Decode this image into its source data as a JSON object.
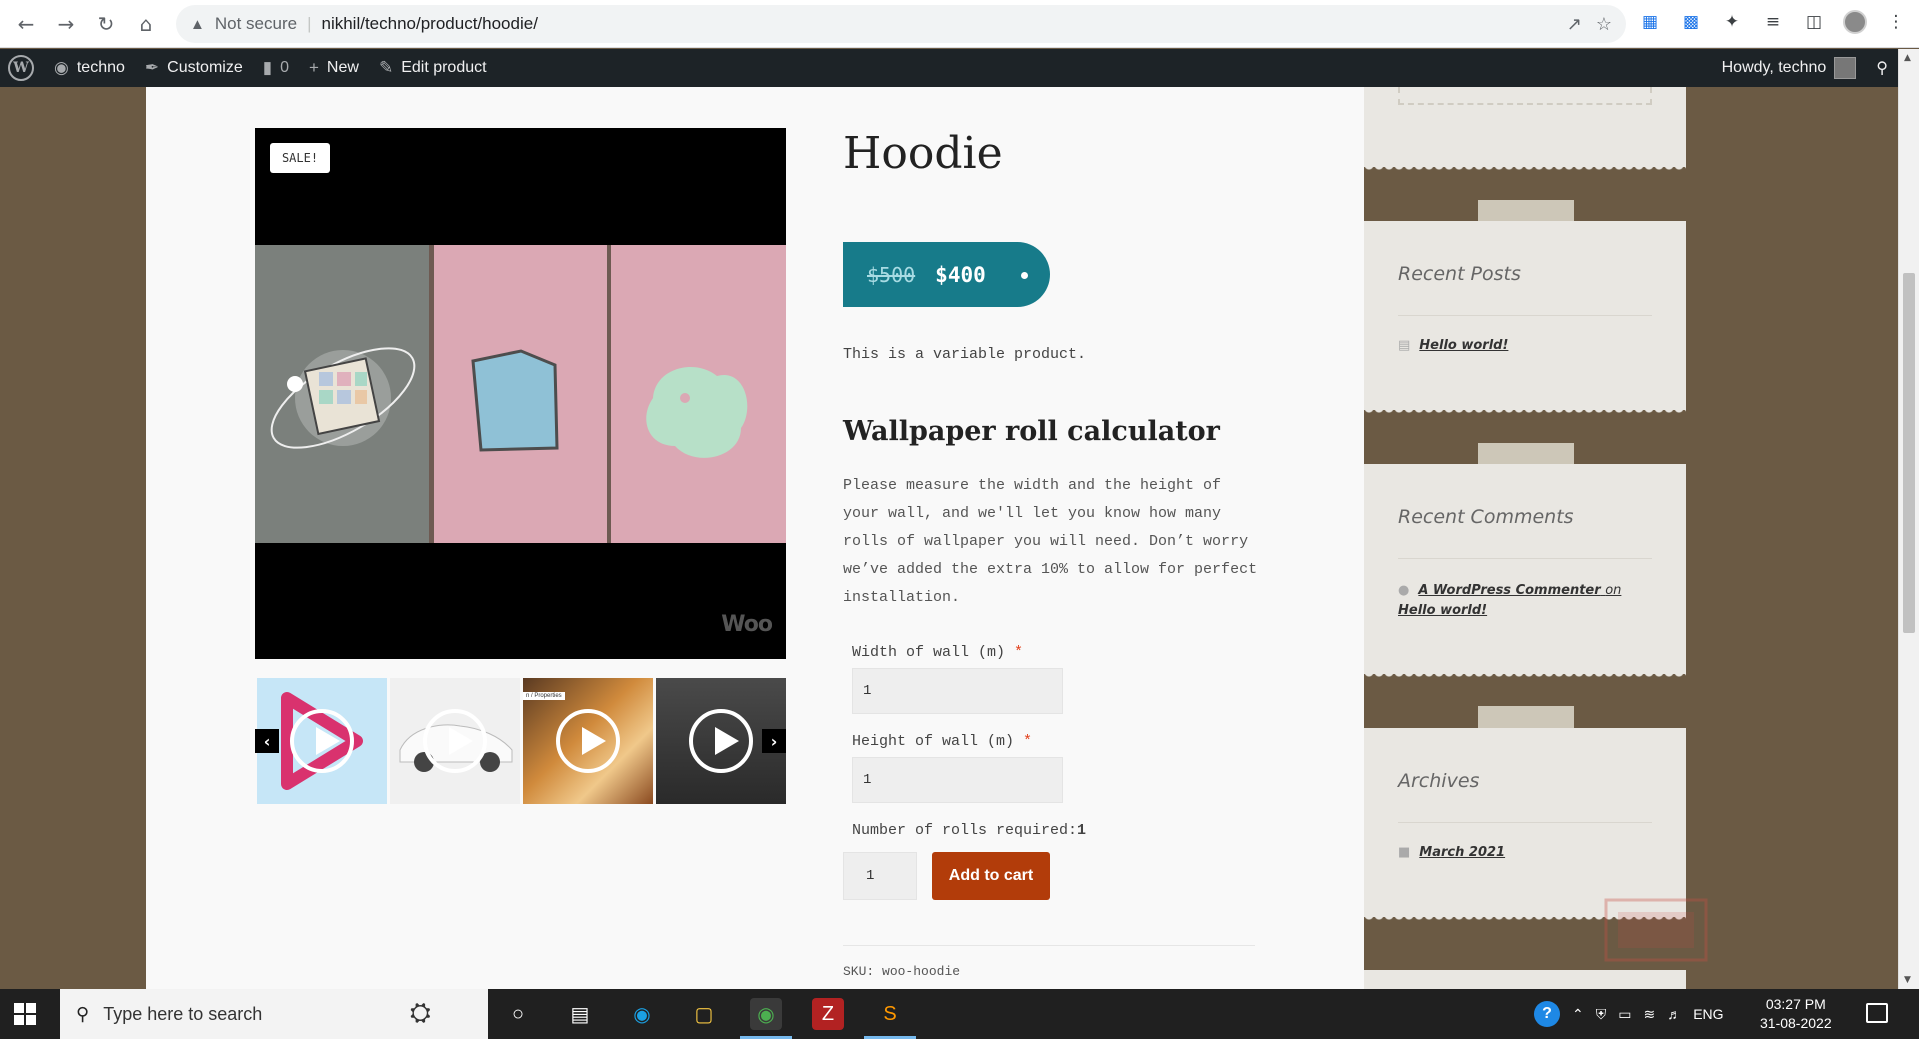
{
  "browser": {
    "security_label": "Not secure",
    "url": "nikhil/techno/product/hoodie/"
  },
  "adminbar": {
    "site_name": "techno",
    "customize": "Customize",
    "comments_count": "0",
    "new_label": "New",
    "edit_label": "Edit product",
    "howdy": "Howdy, techno"
  },
  "product": {
    "sale_badge": "SALE!",
    "title": "Hoodie",
    "price_old": "$500",
    "price_new": "$400",
    "short_description": "This is a variable product.",
    "brand_watermark": "Woo",
    "sku_label": "SKU:",
    "sku_value": "woo-hoodie",
    "quantity": "1",
    "add_to_cart": "Add to cart"
  },
  "calculator": {
    "title": "Wallpaper roll calculator",
    "description": "Please measure the width and the height of your wall, and we'll let you know how many rolls of wallpaper you will need. Don’t worry we’ve added the extra 10% to allow for perfect installation.",
    "width_label": "Width of wall (m)",
    "width_value": "1",
    "height_label": "Height of wall (m)",
    "height_value": "1",
    "rolls_label": "Number of rolls required:",
    "rolls_value": "1",
    "required_mark": "*"
  },
  "gallery": {
    "thumbnails": [
      {
        "name": "thumb-play-logo",
        "bg": "#c6e6f7"
      },
      {
        "name": "thumb-car",
        "bg": "#e8e8e8"
      },
      {
        "name": "thumb-food",
        "bg": "#c2752e"
      },
      {
        "name": "thumb-city",
        "bg": "#3a3a3a"
      }
    ],
    "thumb_food_caption": "n / Properties"
  },
  "sidebar": {
    "recent_posts_title": "Recent Posts",
    "recent_post": "Hello world!",
    "recent_comments_title": "Recent Comments",
    "comment_author": "A WordPress Commenter",
    "comment_on": "on",
    "comment_post": "Hello world!",
    "archives_title": "Archives",
    "archive_item": "March 2021"
  },
  "taskbar": {
    "search_placeholder": "Type here to search",
    "language": "ENG",
    "time": "03:27 PM",
    "date": "31-08-2022"
  },
  "colors": {
    "price_pill": "#177b8a",
    "add_to_cart": "#b23c0a",
    "admin_bar": "#1d2327",
    "page_background": "#6b5a44"
  }
}
